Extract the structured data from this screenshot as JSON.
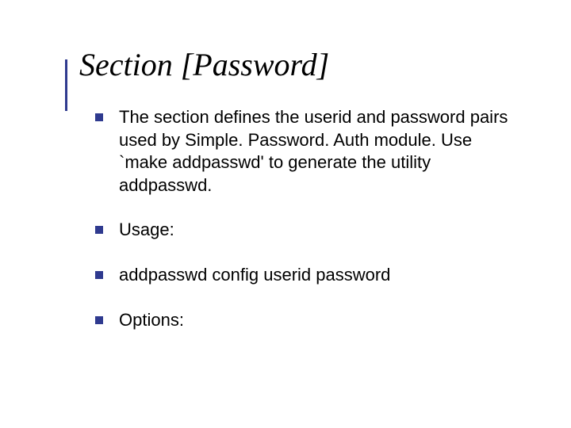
{
  "title": "Section [Password]",
  "bullets": [
    "The section defines the userid and password pairs used by Simple. Password. Auth module. Use `make addpasswd' to generate the utility addpasswd.",
    "Usage:",
    "addpasswd config userid password",
    "Options:"
  ]
}
